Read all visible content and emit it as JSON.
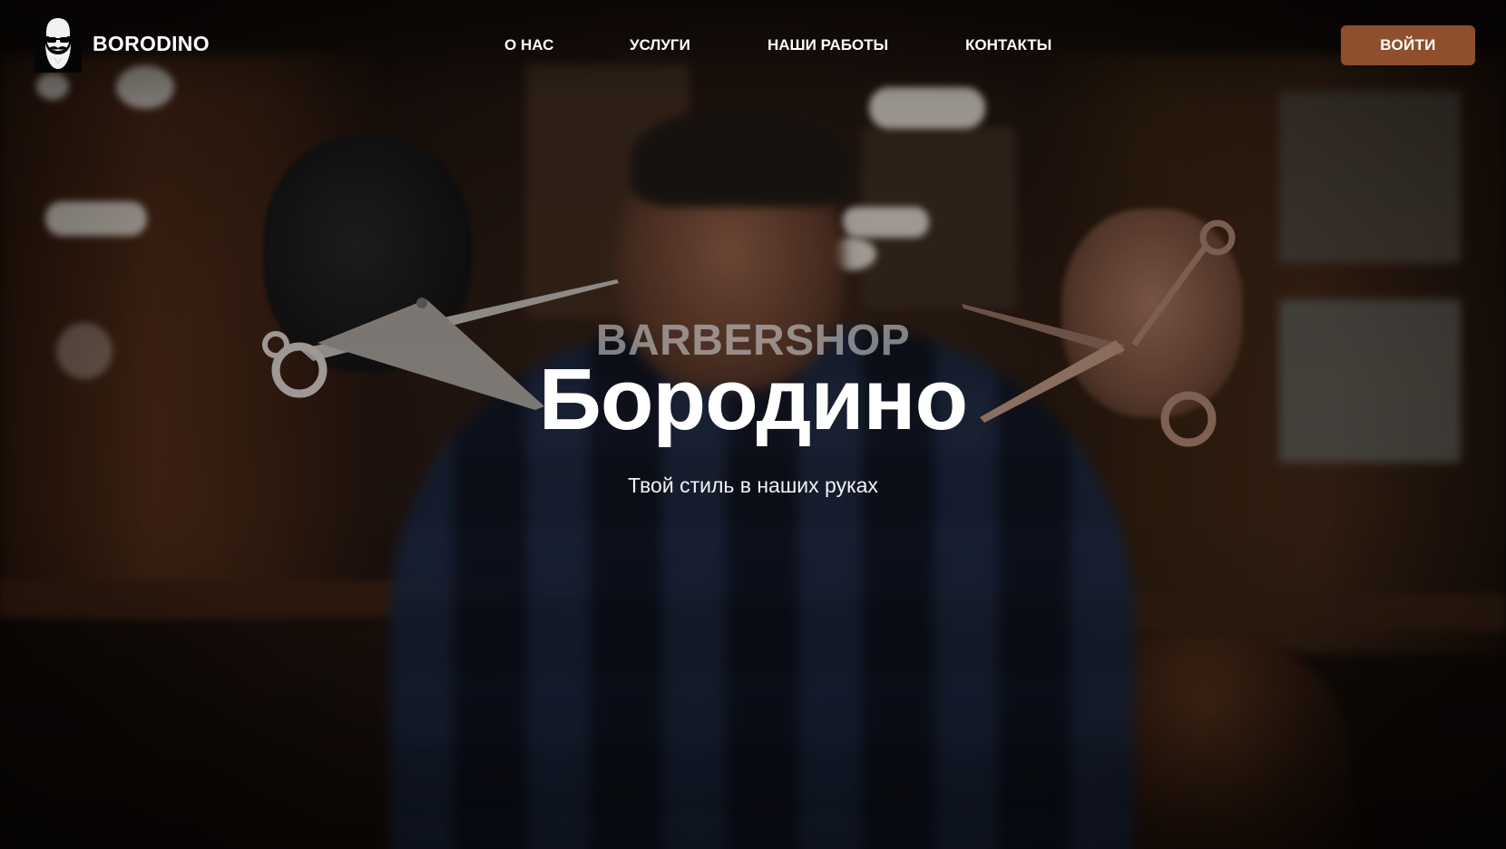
{
  "header": {
    "logo": {
      "icon": "bearded-man-icon",
      "name": "BORODINO"
    },
    "nav": [
      {
        "label": "О НАС"
      },
      {
        "label": "УСЛУГИ"
      },
      {
        "label": "НАШИ РАБОТЫ"
      },
      {
        "label": "КОНТАКТЫ"
      }
    ],
    "login_label": "ВОЙТИ"
  },
  "hero": {
    "kicker": "BARBERSHOP",
    "title": "Бородино",
    "tagline": "Твой стиль в наших руках"
  },
  "colors": {
    "accent": "#8f4f2c",
    "text": "#ffffff",
    "kicker": "#bdbdbd",
    "background": "#1a0f08"
  }
}
